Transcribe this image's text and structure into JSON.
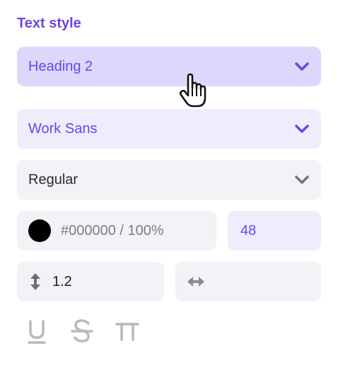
{
  "panel": {
    "title": "Text style"
  },
  "style_select": {
    "value": "Heading 2",
    "icon": "chevron-down-icon"
  },
  "font_select": {
    "value": "Work Sans",
    "icon": "chevron-down-icon"
  },
  "weight_select": {
    "value": "Regular",
    "icon": "chevron-down-icon"
  },
  "color": {
    "swatch": "#000000",
    "value": "#000000 / 100%"
  },
  "font_size": {
    "value": "48"
  },
  "line_height": {
    "icon": "vertical-resize-icon",
    "value": "1.2"
  },
  "letter_spacing": {
    "icon": "horizontal-resize-icon",
    "value": ""
  },
  "decorations": {
    "underline_icon": "underline-icon",
    "strikethrough_icon": "strikethrough-icon",
    "case_icon": "text-case-icon"
  },
  "colors": {
    "accent": "#6a45e8",
    "selected_bg": "#ddd8fb",
    "secondary_bg": "#efedfc",
    "field_bg": "#f2f2f7"
  }
}
